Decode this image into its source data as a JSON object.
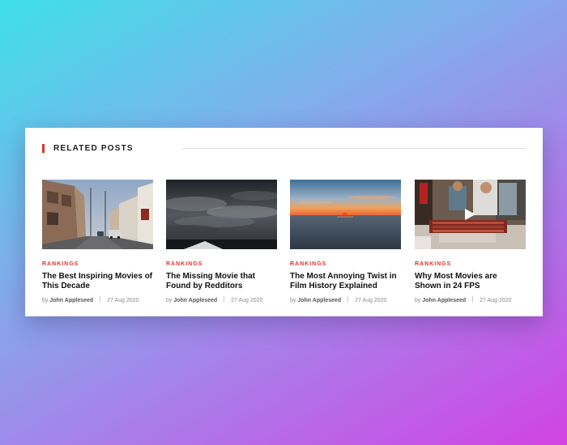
{
  "section": {
    "title": "RELATED POSTS"
  },
  "posts": [
    {
      "category": "RANKINGS",
      "title": "The Best Inspiring Movies of This Decade",
      "by": "by",
      "author": "John Appleseed",
      "date": "27 Aug 2020",
      "thumbnail": "street-photo"
    },
    {
      "category": "RANKINGS",
      "title": "The Missing Movie that Found by Redditors",
      "by": "by",
      "author": "John Appleseed",
      "date": "27 Aug 2020",
      "thumbnail": "stormy-sky-photo"
    },
    {
      "category": "RANKINGS",
      "title": "The Most Annoying Twist in Film History Explained",
      "by": "by",
      "author": "John Appleseed",
      "date": "27 Aug 2020",
      "thumbnail": "ocean-sunset-photo"
    },
    {
      "category": "RANKINGS",
      "title": "Why Most Movies are Shown in 24 FPS",
      "by": "by",
      "author": "John Appleseed",
      "date": "27 Aug 2020",
      "thumbnail": "street-food-video",
      "has_video": true
    }
  ]
}
